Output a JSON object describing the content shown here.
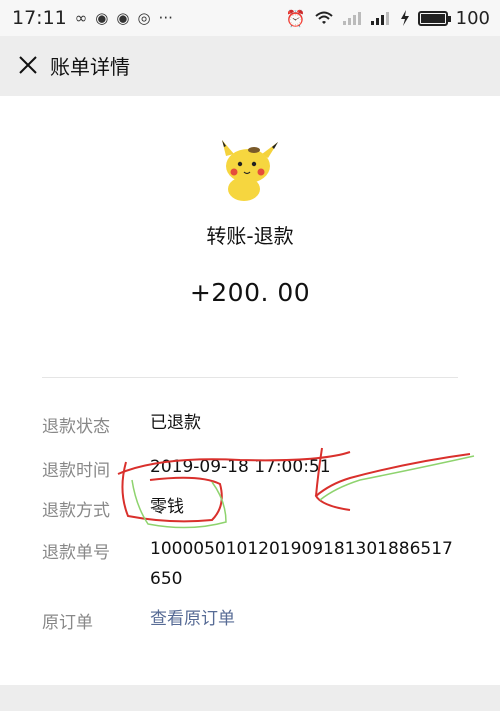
{
  "status_bar": {
    "time": "17:11",
    "battery": "100",
    "left_icons": [
      "infinity-icon",
      "app-icon",
      "app-icon",
      "weibo-icon",
      "more-dots-icon"
    ],
    "right_icons": [
      "alarm-icon",
      "wifi-icon",
      "signal-icon",
      "signal-4g-icon",
      "charging-icon",
      "battery-icon"
    ]
  },
  "nav": {
    "title": "账单详情",
    "close_icon": "close-icon"
  },
  "bill": {
    "avatar_icon": "pikachu-avatar-icon",
    "transaction_type": "转账-退款",
    "amount": "+200. 00",
    "rows": [
      {
        "label": "退款状态",
        "value": "已退款"
      },
      {
        "label": "退款时间",
        "value": "2019-09-18 17:00:51"
      },
      {
        "label": "退款方式",
        "value": "零钱"
      },
      {
        "label": "退款单号",
        "value_line1": "1000050101201909181301886517",
        "value_line2": "650"
      },
      {
        "label": "原订单",
        "value": "查看原订单"
      }
    ]
  },
  "colors": {
    "background": "#ededed",
    "card": "#ffffff",
    "label_gray": "#888888",
    "link_blue": "#576b95",
    "annotation_red": "#d9302c",
    "annotation_green": "#8ed36e"
  }
}
